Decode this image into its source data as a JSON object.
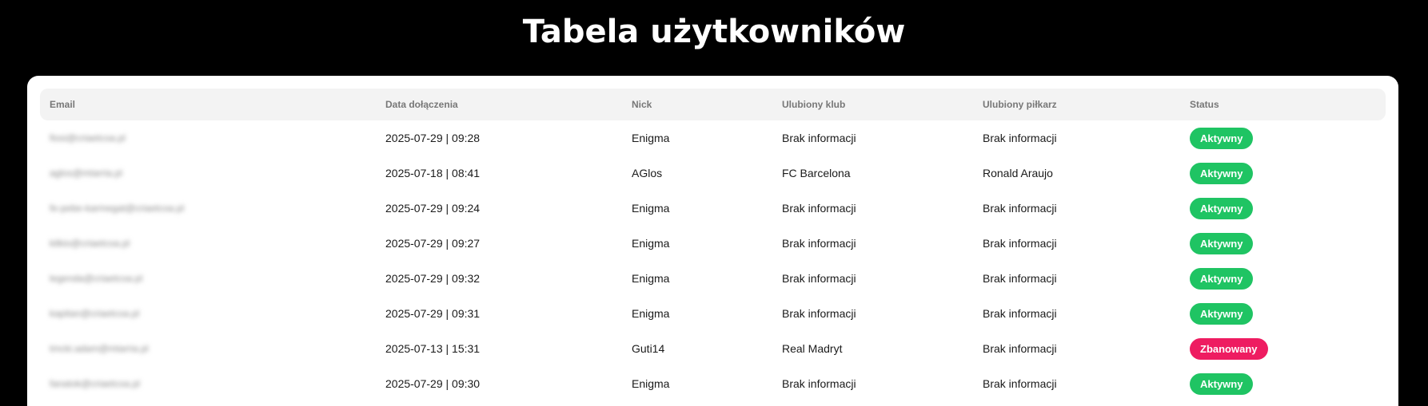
{
  "page": {
    "title": "Tabela użytkowników"
  },
  "table": {
    "headers": [
      "Email",
      "Data dołączenia",
      "Nick",
      "Ulubiony klub",
      "Ulubiony piłkarz",
      "Status"
    ],
    "rows": [
      {
        "email": "fiosi@criaetcoa.pl",
        "joined": "2025-07-29 | 09:28",
        "nick": "Enigma",
        "club": "Brak informacji",
        "player": "Brak informacji",
        "status": "Aktywny",
        "status_color": "#1fc463"
      },
      {
        "email": "aglos@mtarria.pl",
        "joined": "2025-07-18 | 08:41",
        "nick": "AGlos",
        "club": "FC Barcelona",
        "player": "Ronald Araujo",
        "status": "Aktywny",
        "status_color": "#1fc463"
      },
      {
        "email": "fe-pebe-karmegat@criaetcoa.pl",
        "joined": "2025-07-29 | 09:24",
        "nick": "Enigma",
        "club": "Brak informacji",
        "player": "Brak informacji",
        "status": "Aktywny",
        "status_color": "#1fc463"
      },
      {
        "email": "kilkio@criaetcoa.pl",
        "joined": "2025-07-29 | 09:27",
        "nick": "Enigma",
        "club": "Brak informacji",
        "player": "Brak informacji",
        "status": "Aktywny",
        "status_color": "#1fc463"
      },
      {
        "email": "legenda@criaetcoa.pl",
        "joined": "2025-07-29 | 09:32",
        "nick": "Enigma",
        "club": "Brak informacji",
        "player": "Brak informacji",
        "status": "Aktywny",
        "status_color": "#1fc463"
      },
      {
        "email": "kapitan@criaetcoa.pl",
        "joined": "2025-07-29 | 09:31",
        "nick": "Enigma",
        "club": "Brak informacji",
        "player": "Brak informacji",
        "status": "Aktywny",
        "status_color": "#1fc463"
      },
      {
        "email": "tmcki.adam@mtarria.pl",
        "joined": "2025-07-13 | 15:31",
        "nick": "Guti14",
        "club": "Real Madryt",
        "player": "Brak informacji",
        "status": "Zbanowany",
        "status_color": "#ee1c61"
      },
      {
        "email": "fanatok@criaetcoa.pl",
        "joined": "2025-07-29 | 09:30",
        "nick": "Enigma",
        "club": "Brak informacji",
        "player": "Brak informacji",
        "status": "Aktywny",
        "status_color": "#1fc463"
      }
    ]
  }
}
